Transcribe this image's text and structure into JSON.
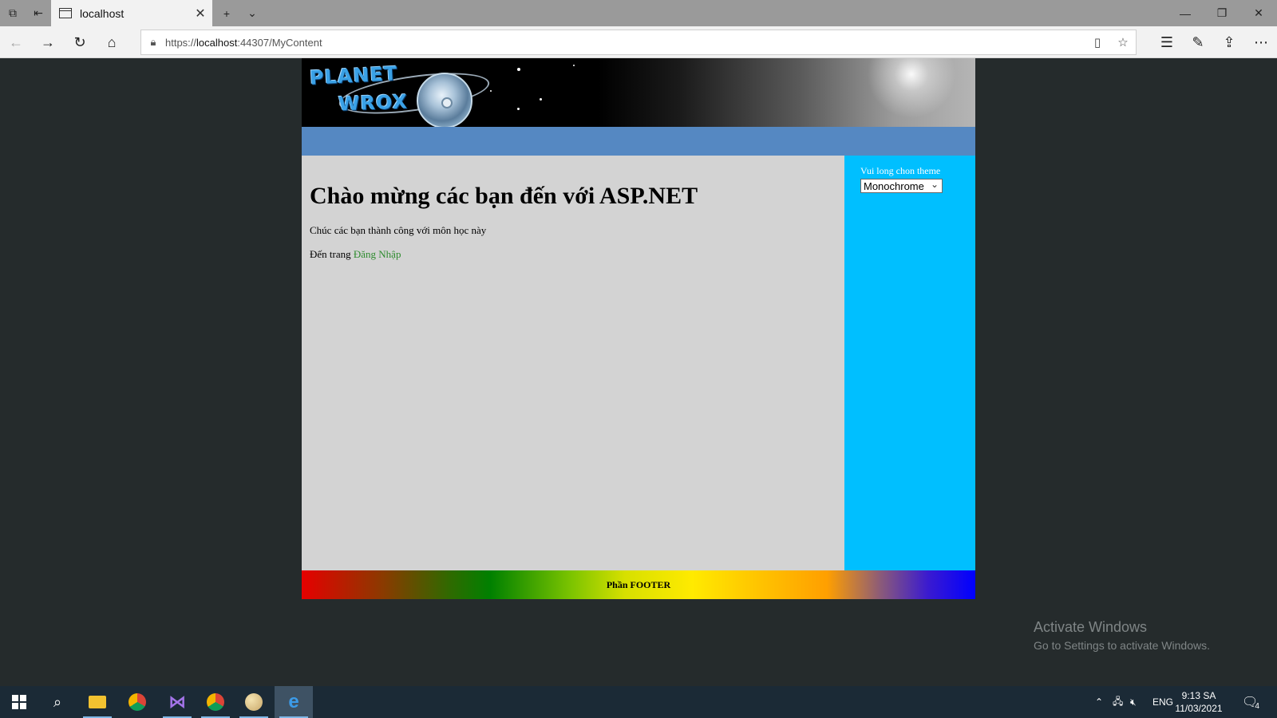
{
  "browser": {
    "tab_title": "localhost",
    "url_prefix": "https://",
    "url_host": "localhost",
    "url_rest": ":44307/MyContent"
  },
  "site": {
    "heading": "Chào mừng các bạn đến với ASP.NET",
    "paragraph": "Chúc các bạn thành công với môn học này",
    "goto_prefix": "Đến trang",
    "login_link": "Đăng Nhập",
    "theme_label": "Vui long chon theme",
    "theme_selected": "Monochrome",
    "footer_text": "Phần FOOTER",
    "colors": {
      "menu_bar": "#5588c2",
      "main_bg": "#d3d3d3",
      "sidebar_bg": "#00bfff",
      "link": "#2e8b2e"
    }
  },
  "watermark": {
    "title": "Activate Windows",
    "subtitle": "Go to Settings to activate Windows."
  },
  "taskbar": {
    "language": "ENG",
    "time": "9:13 SA",
    "date": "11/03/2021",
    "notification_count": "4"
  }
}
